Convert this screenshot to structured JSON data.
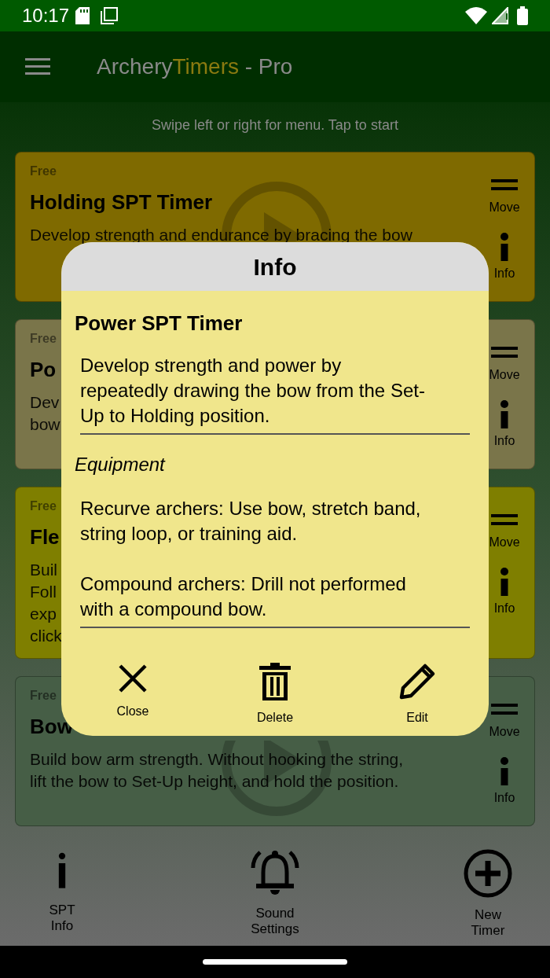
{
  "status_bar": {
    "time": "10:17"
  },
  "app_bar": {
    "title": [
      {
        "text": "Archery",
        "kind": "plain"
      },
      {
        "text": "Timers",
        "kind": "accent"
      },
      {
        "text": "- Pro",
        "kind": "plain"
      }
    ]
  },
  "hint": "Swipe left or right for menu. Tap to start",
  "timers": [
    {
      "badge": "Free",
      "title": "Holding SPT Timer",
      "description_lines": [
        "Develop strength and endurance by bracing the bow"
      ],
      "color": "#7f6a00",
      "play": {
        "kind": "upper"
      },
      "move_label": "Move",
      "info_label": "Info"
    },
    {
      "badge": "Free",
      "title": "Po",
      "description_lines": [
        "Dev",
        "bow"
      ],
      "color": "#7a754a",
      "move_label": "Move",
      "info_label": "Info"
    },
    {
      "badge": "Free",
      "title": "Fle",
      "description_lines": [
        "Buil",
        "Foll",
        "exp",
        "click"
      ],
      "color": "#7f7f00",
      "move_label": "Move",
      "info_label": "Info"
    },
    {
      "badge": "Free",
      "title": "Bow",
      "description_lines": [
        "Build bow arm strength. Without hooking the string,",
        "lift the bow to Set-Up height, and hold the position."
      ],
      "color": "#465e46",
      "play": {
        "kind": "lower"
      },
      "move_label": "Move",
      "info_label": "Info"
    }
  ],
  "bottom_bar": [
    {
      "kind": "info",
      "label": [
        "SPT",
        "Info"
      ]
    },
    {
      "kind": "bell",
      "label": [
        "Sound",
        "Settings"
      ]
    },
    {
      "kind": "add",
      "label": [
        "New",
        "Timer"
      ]
    }
  ],
  "dialog": {
    "header": "Info",
    "title": "Power SPT Timer",
    "description": "Develop strength and power by repeatedly drawing the bow from the Set-Up to Holding position.",
    "equipment_heading": "Equipment",
    "equipment": [
      "Recurve archers: Use bow, stretch band, string loop, or training aid.",
      "Compound archers: Drill not performed with a compound bow."
    ],
    "actions": [
      {
        "kind": "close",
        "label": "Close"
      },
      {
        "kind": "delete",
        "label": "Delete"
      },
      {
        "kind": "edit",
        "label": "Edit"
      }
    ]
  }
}
